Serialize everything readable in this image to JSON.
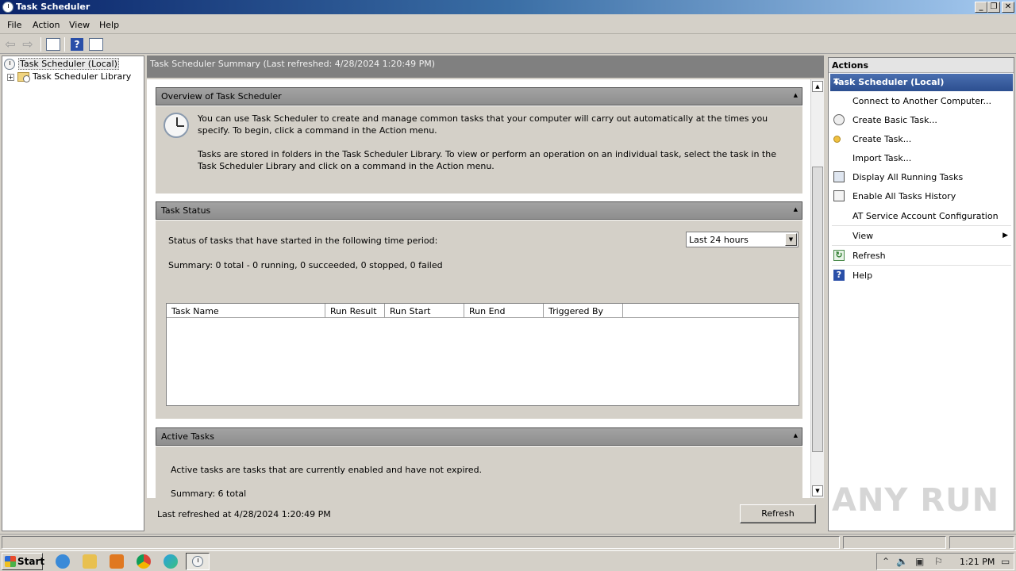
{
  "window": {
    "title": "Task Scheduler",
    "controls": [
      "minimize",
      "restore",
      "close"
    ]
  },
  "menu": {
    "items": [
      {
        "label": "File"
      },
      {
        "label": "Action"
      },
      {
        "label": "View"
      },
      {
        "label": "Help"
      }
    ]
  },
  "toolbar": {
    "buttons": [
      "back-icon",
      "forward-icon",
      "show-hide-console-tree-icon",
      "help-icon",
      "show-hide-action-pane-icon"
    ]
  },
  "tree": {
    "root": {
      "label": "Task Scheduler (Local)"
    },
    "children": [
      {
        "label": "Task Scheduler Library",
        "expander": "+"
      }
    ]
  },
  "center": {
    "header": "Task Scheduler Summary (Last refreshed: 4/28/2024 1:20:49 PM)",
    "overview": {
      "title": "Overview of Task Scheduler",
      "para1": "You can use Task Scheduler to create and manage common tasks that your computer will carry out automatically at the times you specify. To begin, click a command in the Action menu.",
      "para2": "Tasks are stored in folders in the Task Scheduler Library. To view or perform an operation on an individual task, select the task in the Task Scheduler Library and click on a command in the Action menu."
    },
    "status": {
      "title": "Task Status",
      "period_label": "Status of tasks that have started in the following time period:",
      "period_value": "Last 24 hours",
      "summary": "Summary: 0 total - 0 running, 0 succeeded, 0 stopped, 0 failed",
      "columns": [
        "Task Name",
        "Run Result",
        "Run Start",
        "Run End",
        "Triggered By"
      ],
      "rows": []
    },
    "active": {
      "title": "Active Tasks",
      "description": "Active tasks are tasks that are currently enabled and have not expired.",
      "summary": "Summary: 6 total"
    },
    "footer": {
      "last_refreshed": "Last refreshed at 4/28/2024 1:20:49 PM",
      "refresh_label": "Refresh"
    }
  },
  "actions": {
    "title": "Actions",
    "group": "Task Scheduler (Local)",
    "items": [
      {
        "label": "Connect to Another Computer...",
        "icon": "none"
      },
      {
        "label": "Create Basic Task...",
        "icon": "create-basic-task-icon"
      },
      {
        "label": "Create Task...",
        "icon": "create-task-icon"
      },
      {
        "label": "Import Task...",
        "icon": "none"
      },
      {
        "label": "Display All Running Tasks",
        "icon": "display-running-tasks-icon"
      },
      {
        "label": "Enable All Tasks History",
        "icon": "tasks-history-icon"
      },
      {
        "label": "AT Service Account Configuration",
        "icon": "none"
      },
      {
        "label": "View",
        "icon": "none",
        "submenu": true
      },
      {
        "label": "Refresh",
        "icon": "refresh-icon"
      },
      {
        "label": "Help",
        "icon": "help-icon"
      }
    ]
  },
  "taskbar": {
    "start_label": "Start",
    "pinned": [
      "internet-explorer-icon",
      "file-explorer-icon",
      "media-player-icon",
      "chrome-icon",
      "edge-icon",
      "task-scheduler-icon"
    ],
    "clock": "1:21 PM"
  },
  "watermark": "ANY RUN"
}
